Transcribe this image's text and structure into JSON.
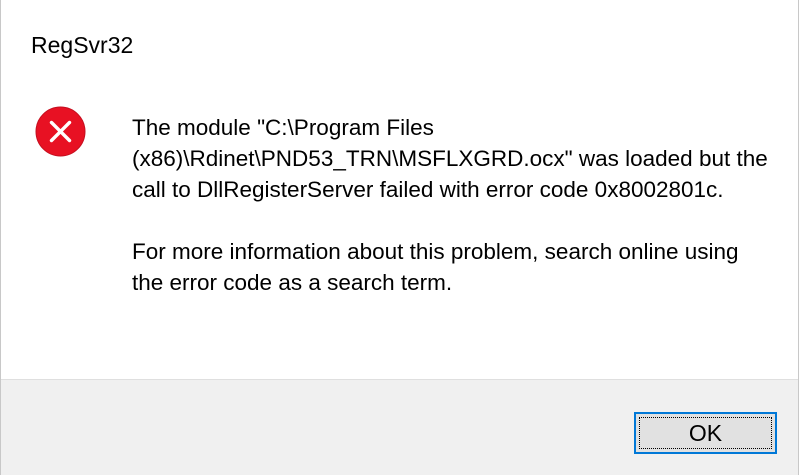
{
  "window": {
    "title": "RegSvr32"
  },
  "icon": {
    "name": "error-icon",
    "color": "#e81123"
  },
  "message": {
    "main_text": "The module \"C:\\Program Files (x86)\\Rdinet\\PND53_TRN\\MSFLXGRD.ocx\" was loaded but the call to DllRegisterServer failed with error code 0x8002801c.",
    "secondary_text": "For more information about this problem, search online using the error code as a search term."
  },
  "buttons": {
    "ok_label": "OK"
  },
  "colors": {
    "footer_background": "#f0f0f0",
    "button_border_accent": "#0078d7"
  }
}
